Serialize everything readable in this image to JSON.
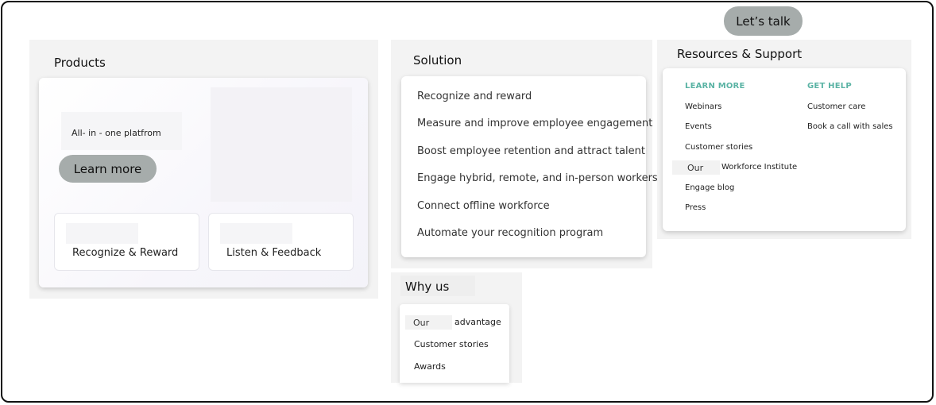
{
  "header": {
    "cta_label": "Let’s talk"
  },
  "products": {
    "title": "Products",
    "platform_text": "All- in - one platfrom",
    "learn_more": "Learn more",
    "cards": [
      {
        "label": "Recognize & Reward"
      },
      {
        "label": "Listen & Feedback"
      }
    ]
  },
  "solution": {
    "title": "Solution",
    "items": [
      "Recognize and reward",
      "Measure and improve employee engagement",
      "Boost employee retention and attract talent",
      "Engage hybrid, remote, and in-person workers",
      "Connect offline workforce",
      "Automate your recognition program"
    ]
  },
  "resources": {
    "title": "Resources & Support",
    "learn_more_heading": "LEARN MORE",
    "learn_more_items": [
      "Webinars",
      "Events",
      "Customer stories",
      "Engage blog",
      "Press"
    ],
    "workforce": {
      "prefix": "Our",
      "suffix": "Workforce Institute"
    },
    "get_help_heading": "GET HELP",
    "get_help_items": [
      "Customer care",
      "Book a call with sales"
    ],
    "heading_color": "#5ab3a4"
  },
  "why_us": {
    "title": "Why us",
    "advantage": {
      "prefix": "Our",
      "suffix": "advantage"
    },
    "items": [
      "Customer stories",
      "Awards"
    ]
  }
}
